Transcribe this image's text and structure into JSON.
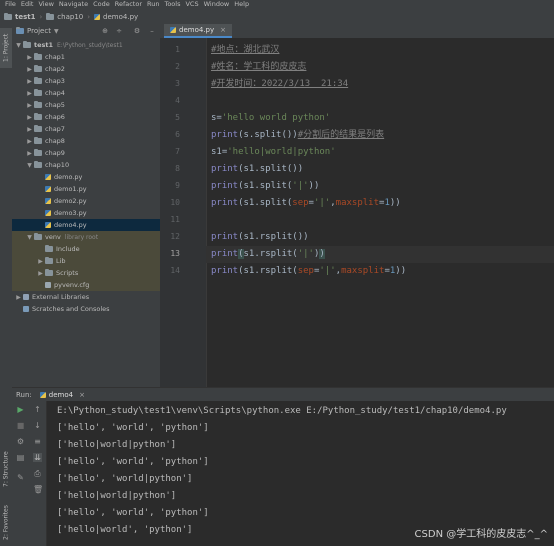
{
  "menu": [
    "File",
    "Edit",
    "View",
    "Navigate",
    "Code",
    "Refactor",
    "Run",
    "Tools",
    "VCS",
    "Window",
    "Help"
  ],
  "breadcrumb": {
    "project": "test1",
    "folder": "chap10",
    "file": "demo4.py"
  },
  "left_tabs": {
    "project": "1: Project",
    "structure": "7: Structure",
    "favorites": "2: Favorites"
  },
  "project_panel": {
    "title": "Project"
  },
  "tree": [
    {
      "label": "test1",
      "sub": "E:\\Python_study\\test1",
      "icon": "folder",
      "arrow": "▼",
      "bold": true
    },
    {
      "label": "chap1",
      "icon": "folder",
      "arrow": "▶"
    },
    {
      "label": "chap2",
      "icon": "folder",
      "arrow": "▶"
    },
    {
      "label": "chap3",
      "icon": "folder",
      "arrow": "▶"
    },
    {
      "label": "chap4",
      "icon": "folder",
      "arrow": "▶"
    },
    {
      "label": "chap5",
      "icon": "folder",
      "arrow": "▶"
    },
    {
      "label": "chap6",
      "icon": "folder",
      "arrow": "▶"
    },
    {
      "label": "chap7",
      "icon": "folder",
      "arrow": "▶"
    },
    {
      "label": "chap8",
      "icon": "folder",
      "arrow": "▶"
    },
    {
      "label": "chap9",
      "icon": "folder",
      "arrow": "▶"
    },
    {
      "label": "chap10",
      "icon": "folder",
      "arrow": "▼"
    },
    {
      "label": "demo.py",
      "icon": "python"
    },
    {
      "label": "demo1.py",
      "icon": "python"
    },
    {
      "label": "demo2.py",
      "icon": "python"
    },
    {
      "label": "demo3.py",
      "icon": "python"
    },
    {
      "label": "demo4.py",
      "icon": "python",
      "selected": true
    },
    {
      "label": "venv",
      "sub": "library root",
      "icon": "folder",
      "arrow": "▼",
      "highlight": true
    },
    {
      "label": "Include",
      "icon": "folder",
      "highlight": true
    },
    {
      "label": "Lib",
      "icon": "folder",
      "arrow": "▶",
      "highlight": true
    },
    {
      "label": "Scripts",
      "icon": "folder",
      "arrow": "▶",
      "highlight": true
    },
    {
      "label": "pyvenv.cfg",
      "icon": "file",
      "highlight": true
    },
    {
      "label": "External Libraries",
      "icon": "library",
      "arrow": "▶"
    },
    {
      "label": "Scratches and Consoles",
      "icon": "scratch"
    }
  ],
  "editor": {
    "tab": "demo4.py",
    "current_line": 13,
    "lines": [
      [
        {
          "t": "#地点：湖北武汉",
          "c": "com"
        }
      ],
      [
        {
          "t": "#姓名：学工科的皮皮志",
          "c": "com"
        }
      ],
      [
        {
          "t": "#开发时间：2022/3/13  21:34",
          "c": "com"
        }
      ],
      [],
      [
        {
          "t": "s",
          "c": "def"
        },
        {
          "t": "=",
          "c": "def"
        },
        {
          "t": "'hello world python'",
          "c": "str"
        }
      ],
      [
        {
          "t": "print",
          "c": "kw"
        },
        {
          "t": "(s.split())",
          "c": "def"
        },
        {
          "t": "#分割后的结果是列表",
          "c": "com"
        }
      ],
      [
        {
          "t": "s1",
          "c": "def"
        },
        {
          "t": "=",
          "c": "def"
        },
        {
          "t": "'hello|world|python'",
          "c": "str"
        }
      ],
      [
        {
          "t": "print",
          "c": "kw"
        },
        {
          "t": "(s1.split())",
          "c": "def"
        }
      ],
      [
        {
          "t": "print",
          "c": "kw"
        },
        {
          "t": "(s1.split(",
          "c": "def"
        },
        {
          "t": "'|'",
          "c": "str"
        },
        {
          "t": "))",
          "c": "def"
        }
      ],
      [
        {
          "t": "print",
          "c": "kw"
        },
        {
          "t": "(s1.split(",
          "c": "def"
        },
        {
          "t": "sep",
          "c": "par"
        },
        {
          "t": "=",
          "c": "def"
        },
        {
          "t": "'|'",
          "c": "str"
        },
        {
          "t": ",",
          "c": "def"
        },
        {
          "t": "maxsplit",
          "c": "par"
        },
        {
          "t": "=",
          "c": "def"
        },
        {
          "t": "1",
          "c": "num"
        },
        {
          "t": "))",
          "c": "def"
        }
      ],
      [],
      [
        {
          "t": "print",
          "c": "kw"
        },
        {
          "t": "(s1.rsplit())",
          "c": "def"
        }
      ],
      [
        {
          "t": "print",
          "c": "kw"
        },
        {
          "t": "(",
          "c": "hi"
        },
        {
          "t": "s1.rsplit(",
          "c": "def"
        },
        {
          "t": "'|'",
          "c": "str"
        },
        {
          "t": ")",
          "c": "def"
        },
        {
          "t": ")",
          "c": "hi"
        }
      ],
      [
        {
          "t": "print",
          "c": "kw"
        },
        {
          "t": "(s1.rsplit(",
          "c": "def"
        },
        {
          "t": "sep",
          "c": "par"
        },
        {
          "t": "=",
          "c": "def"
        },
        {
          "t": "'|'",
          "c": "str"
        },
        {
          "t": ",",
          "c": "def"
        },
        {
          "t": "maxsplit",
          "c": "par"
        },
        {
          "t": "=",
          "c": "def"
        },
        {
          "t": "1",
          "c": "num"
        },
        {
          "t": "))",
          "c": "def"
        }
      ]
    ]
  },
  "run": {
    "label": "Run:",
    "tab": "demo4",
    "output": [
      "E:\\Python_study\\test1\\venv\\Scripts\\python.exe E:/Python_study/test1/chap10/demo4.py",
      "['hello', 'world', 'python']",
      "['hello|world|python']",
      "['hello', 'world', 'python']",
      "['hello', 'world|python']",
      "['hello|world|python']",
      "['hello', 'world', 'python']",
      "['hello|world', 'python']"
    ]
  },
  "watermark": "CSDN @学工科的皮皮志^_^",
  "colors": {
    "accent": "#4a88c7",
    "run_green": "#59a869",
    "stop_red": "#c75450"
  }
}
